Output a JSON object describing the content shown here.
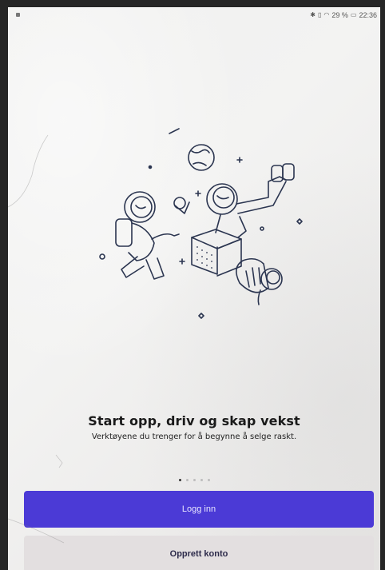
{
  "status_bar": {
    "battery_text": "29 %",
    "time": "22:36",
    "icons": [
      "bluetooth-icon",
      "vibrate-icon",
      "wifi-icon",
      "battery-icon"
    ]
  },
  "onboarding": {
    "headline": "Start opp, driv og skap vekst",
    "subtitle": "Verktøyene du trenger for å begynne å selge raskt.",
    "pager": {
      "total": 5,
      "active_index": 0
    }
  },
  "actions": {
    "login_label": "Logg inn",
    "create_account_label": "Opprett konto"
  },
  "colors": {
    "primary": "#4b3ad6",
    "secondary_bg": "#e3dfe0"
  }
}
